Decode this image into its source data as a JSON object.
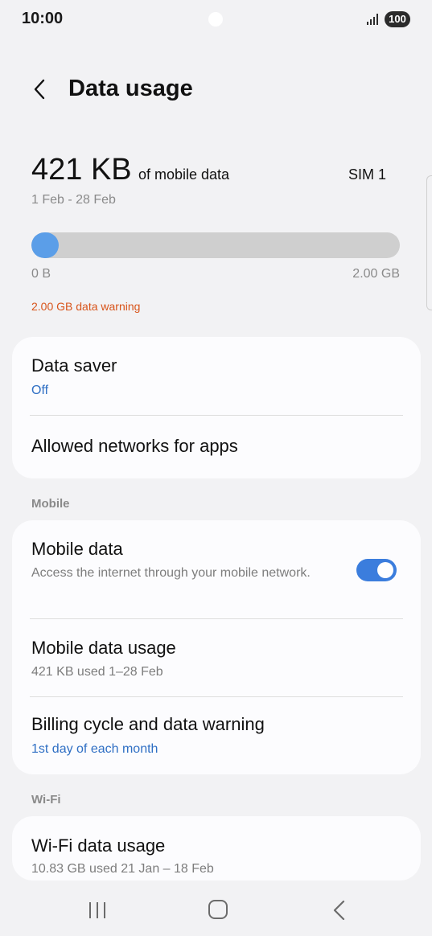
{
  "status_bar": {
    "time": "10:00",
    "battery": "100"
  },
  "header": {
    "title": "Data usage"
  },
  "usage": {
    "amount": "421 KB",
    "suffix": "of mobile data",
    "sim": "SIM 1",
    "date_range": "1 Feb - 28 Feb",
    "bar_min": "0 B",
    "bar_max": "2.00 GB",
    "warning": "2.00 GB data warning",
    "bar_fill_fraction": 0.0002
  },
  "card1": {
    "data_saver": {
      "title": "Data saver",
      "value": "Off"
    },
    "allowed_networks": {
      "title": "Allowed networks for apps"
    }
  },
  "section_mobile": "Mobile",
  "card2": {
    "mobile_data": {
      "title": "Mobile data",
      "subtitle": "Access the internet through your mobile network.",
      "enabled": true
    },
    "mobile_data_usage": {
      "title": "Mobile data usage",
      "subtitle": "421 KB used 1–28 Feb"
    },
    "billing_cycle": {
      "title": "Billing cycle and data warning",
      "subtitle": "1st day of each month"
    }
  },
  "section_wifi": "Wi-Fi",
  "card3": {
    "wifi_usage": {
      "title": "Wi-Fi data usage",
      "subtitle": "10.83 GB used 21 Jan – 18 Feb"
    }
  },
  "colors": {
    "accent": "#3b7ddd",
    "bar_fill": "#5b9ee8",
    "warning": "#d8541a",
    "link_blue": "#2f6fc4"
  },
  "icons": {
    "back": "chevron-left-icon",
    "signal": "signal-bars-icon",
    "battery": "battery-icon",
    "nav_recents": "recents-icon",
    "nav_home": "home-icon",
    "nav_back": "back-icon"
  }
}
